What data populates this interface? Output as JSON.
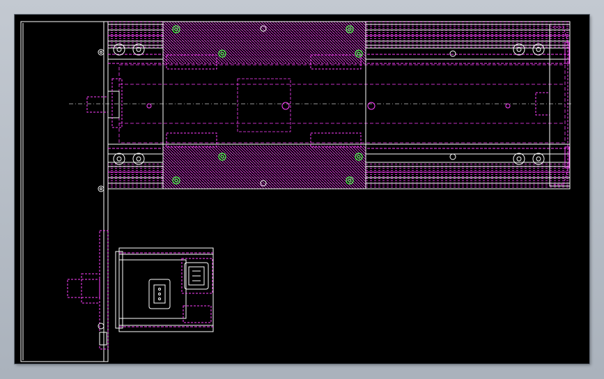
{
  "viewport": {
    "background": "#000000"
  },
  "palette": {
    "outline": "#ffffff",
    "hidden_lines": "#ff40ff",
    "fasteners": "#50ff50",
    "centerline": "#c8c8c8"
  },
  "drawing_parts": [
    "side-plate",
    "linear-module-body",
    "guide-rails",
    "slide-carriage",
    "end-cap",
    "servo-motor",
    "motor-connector",
    "encoder-connector",
    "coupling-shaft"
  ]
}
